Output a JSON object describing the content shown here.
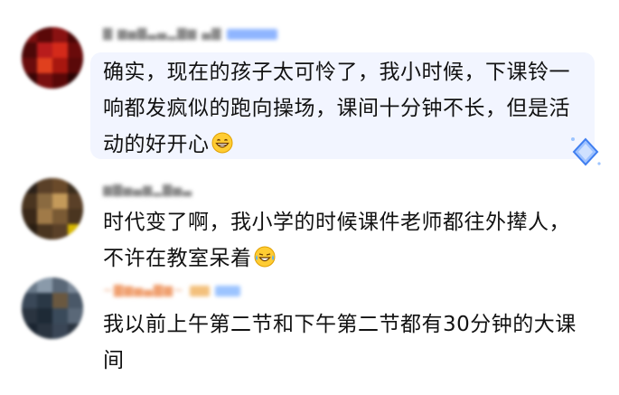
{
  "comments": [
    {
      "username": "▇ ▆▅▇▃▄▂▇▆ ▄▇",
      "badge_color": "#8fb5ff",
      "text": "确实，现在的孩子太可怜了，我小时候，下课铃一响都发疯似的跑向操场，课间十分钟不长，但是活动的好开心",
      "emoji": "grinning-face-icon",
      "highlighted": true
    },
    {
      "username": "▆▇▅▄▆▂▇▅▃",
      "text": "时代变了啊，我小学的时候课件老师都往外撵人，不许在教室呆着",
      "emoji": "crying-laughing-face-icon",
      "highlighted": false
    },
    {
      "username": "~▇▆▅▄▇▆~",
      "badge_color": "#f3c07c",
      "text": "我以前上午第二节和下午第二节都有30分钟的大课间",
      "highlighted": false
    }
  ],
  "colors": {
    "bubble": "#f2f5ff",
    "text": "#121212",
    "username": "#9a9a9a"
  }
}
